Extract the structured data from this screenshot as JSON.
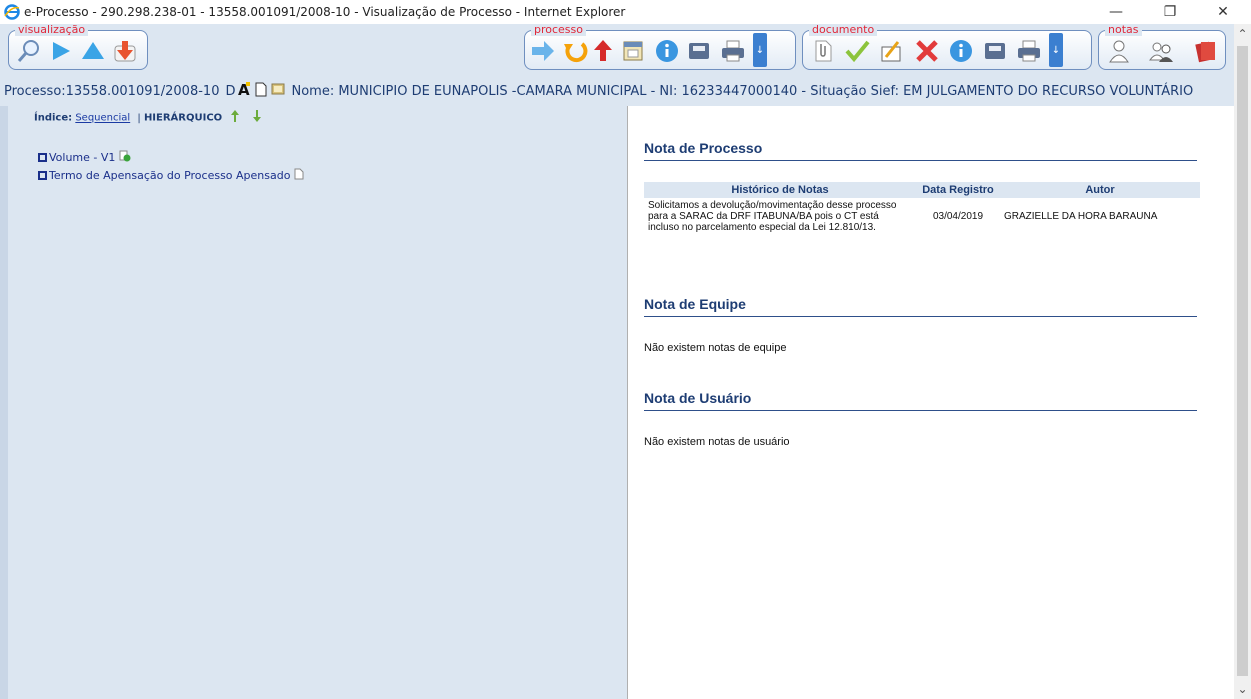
{
  "window": {
    "title": "e-Processo - 290.298.238-01 - 13558.001091/2008-10 - Visualização de Processo - Internet Explorer",
    "minimize": "—",
    "restore": "❐",
    "close": "✕"
  },
  "toolbar": {
    "groups": {
      "visualizacao": "visualização",
      "processo": "processo",
      "documento": "documento",
      "notas": "notas"
    }
  },
  "process_header": {
    "processo": "Processo:13558.001091/2008-10",
    "flag": "D",
    "nome": "Nome: MUNICIPIO DE EUNAPOLIS -CAMARA MUNICIPAL - NI: 16233447000140 - Situação Sief: EM JULGAMENTO DO RECURSO VOLUNTÁRIO"
  },
  "index": {
    "label": "Índice:",
    "sequencial": "Sequencial",
    "separator": "|",
    "hierarquico": "HIERÁRQUICO"
  },
  "tree": {
    "items": [
      {
        "label": "Volume - V1"
      },
      {
        "label": "Termo de Apensação do Processo Apensado"
      }
    ]
  },
  "nota_processo": {
    "title": "Nota de Processo",
    "columns": [
      "Histórico de Notas",
      "Data Registro",
      "Autor"
    ],
    "rows": [
      {
        "historico": "Solicitamos a devolução/movimentação desse processo para a SARAC da DRF ITABUNA/BA pois o CT está incluso no parcelamento especial da Lei 12.810/13.",
        "data": "03/04/2019",
        "autor": "GRAZIELLE DA HORA BARAUNA"
      }
    ]
  },
  "nota_equipe": {
    "title": "Nota de Equipe",
    "empty": "Não existem notas de equipe"
  },
  "nota_usuario": {
    "title": "Nota de Usuário",
    "empty": "Não existem notas de usuário"
  },
  "colors": {
    "panel_bg": "#dce6f1",
    "heading": "#1e3d73",
    "group_label": "#e0283a"
  }
}
